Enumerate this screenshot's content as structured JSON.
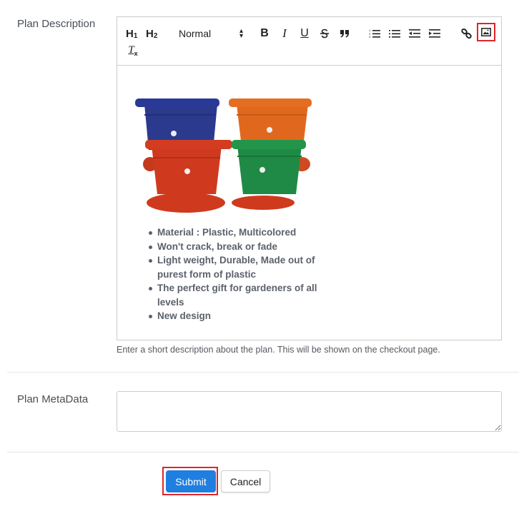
{
  "form": {
    "description": {
      "label": "Plan Description",
      "help_text": "Enter a short description about the plan. This will be shown on the checkout page.",
      "toolbar": {
        "h1_label": "H",
        "h1_sub": "1",
        "h2_label": "H",
        "h2_sub": "2",
        "format_select": "Normal",
        "bold_label": "B",
        "italic_label": "I",
        "underline_label": "U",
        "clean_label": "T",
        "clean_sub": "x",
        "icons": [
          "heading-1-icon",
          "heading-2-icon",
          "format-select",
          "bold-icon",
          "italic-icon",
          "underline-icon",
          "strikethrough-icon",
          "blockquote-icon",
          "ordered-list-icon",
          "bullet-list-icon",
          "outdent-icon",
          "indent-icon",
          "link-icon",
          "image-icon",
          "clear-format-icon"
        ],
        "highlighted_button": "image-icon",
        "highlight_color": "#e0242a"
      },
      "content": {
        "image_alt": "Four plastic flower pots: blue, orange, red and green with saucers",
        "pot_colors": [
          "#2b3a8c",
          "#e0681e",
          "#cf3a1e",
          "#1f8a45"
        ],
        "bullets": [
          "Material : Plastic, Multicolored",
          "Won't crack, break or fade",
          "Light weight, Durable, Made out of purest form of plastic",
          "The perfect gift for gardeners of all levels",
          "New design"
        ]
      }
    },
    "metadata": {
      "label": "Plan MetaData",
      "value": "",
      "placeholder": ""
    },
    "actions": {
      "submit_label": "Submit",
      "cancel_label": "Cancel",
      "submit_color": "#1e7fe0"
    }
  }
}
